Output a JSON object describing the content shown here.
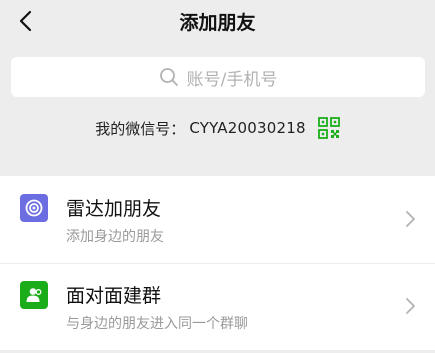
{
  "header": {
    "title": "添加朋友",
    "back_icon": "chevron-left-icon"
  },
  "search": {
    "placeholder": "账号/手机号",
    "icon": "search-icon"
  },
  "my_id": {
    "label": "我的微信号：",
    "value": "CYYA20030218",
    "icon": "qr-code-icon"
  },
  "items": [
    {
      "title": "雷达加朋友",
      "subtitle": "添加身边的朋友",
      "icon": "radar-icon",
      "icon_color": "#6b6de0"
    },
    {
      "title": "面对面建群",
      "subtitle": "与身边的朋友进入同一个群聊",
      "icon": "face-to-face-group-icon",
      "icon_color": "#1aad19"
    }
  ],
  "colors": {
    "background": "#ededed",
    "accent_green": "#1aad19",
    "radar_purple": "#6b6de0"
  }
}
